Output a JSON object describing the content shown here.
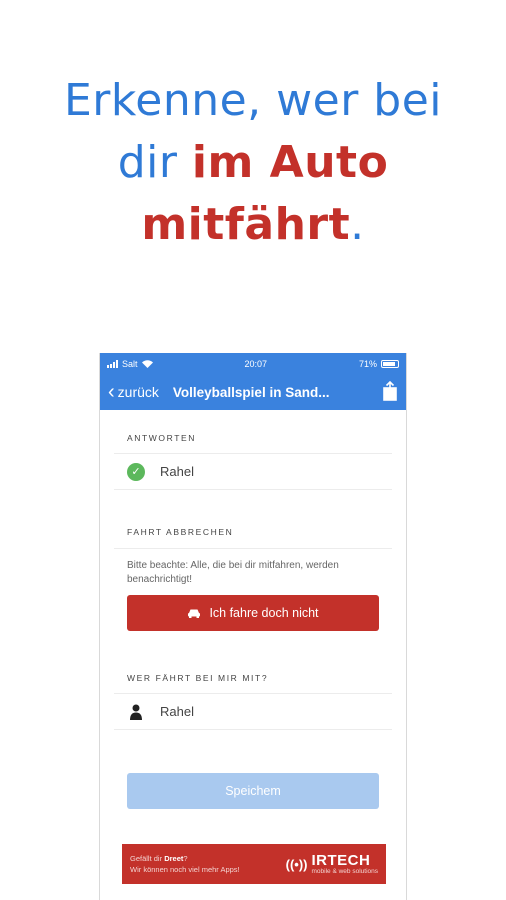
{
  "headline": {
    "line1": "Erkenne, wer bei",
    "line2_plain": "dir ",
    "line2_accent": "im Auto",
    "line3_accent": "mitfährt",
    "line3_plain": "."
  },
  "status_bar": {
    "carrier": "Salt",
    "time": "20:07",
    "battery": "71%"
  },
  "nav": {
    "back_label": "zurück",
    "title": "Volleyballspiel in Sand..."
  },
  "answers": {
    "label": "ANTWORTEN",
    "items": [
      {
        "name": "Rahel"
      }
    ]
  },
  "cancel": {
    "label": "FAHRT ABBRECHEN",
    "note": "Bitte beachte: Alle, die bei dir mitfahren, werden benachrichtigt!",
    "button": "Ich fahre doch nicht"
  },
  "passengers": {
    "label": "WER FÄHRT BEI MIR MIT?",
    "items": [
      {
        "name": "Rahel"
      }
    ]
  },
  "save_button": "Speichem",
  "banner": {
    "line1_prefix": "Gefällt dir ",
    "line1_app": "Dreet",
    "line1_suffix": "?",
    "line2": "Wir können noch viel mehr Apps!",
    "brand": "IRTECH",
    "brand_sub": "mobile & web solutions"
  },
  "colors": {
    "blue": "#3a82de",
    "red": "#c3312a",
    "green": "#5cb85c",
    "save_disabled": "#a9c9ef"
  }
}
